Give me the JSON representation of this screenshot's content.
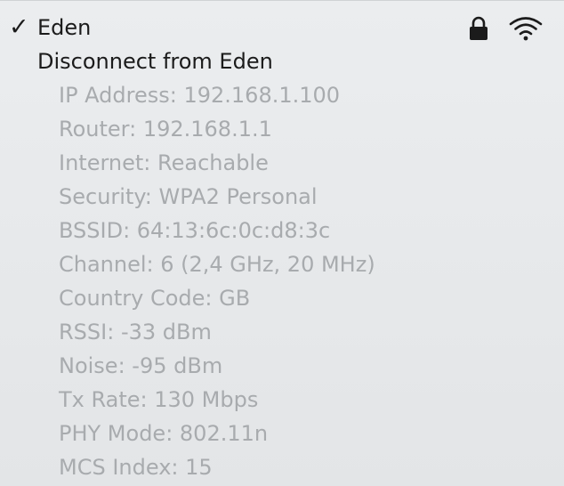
{
  "network": {
    "check_glyph": "✓",
    "name": "Eden",
    "icons": [
      "checkmark-icon",
      "lock-icon",
      "wifi-icon"
    ]
  },
  "disconnect_label": "Disconnect from Eden",
  "details": [
    "IP Address: 192.168.1.100",
    "Router: 192.168.1.1",
    "Internet: Reachable",
    "Security: WPA2 Personal",
    "BSSID: 64:13:6c:0c:d8:3c",
    "Channel: 6 (2,4 GHz, 20 MHz)",
    "Country Code: GB",
    "RSSI: -33 dBm",
    "Noise: -95 dBm",
    "Tx Rate: 130 Mbps",
    "PHY Mode: 802.11n",
    "MCS Index: 15"
  ],
  "colors": {
    "background": "#e8eaec",
    "text": "#1b1b1b",
    "disabled_text": "#a8abae"
  }
}
